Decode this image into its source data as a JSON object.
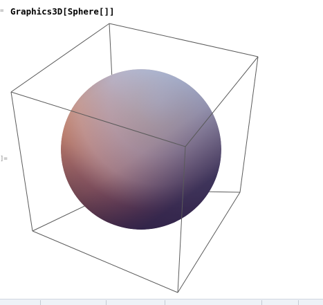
{
  "notebook": {
    "input_marker": "=",
    "input_code": "Graphics3D[Sphere[]]",
    "output_marker": "]="
  },
  "graphic": {
    "object": "sphere",
    "shading_colors": {
      "highlight": "#fffbe0",
      "warm": "#f0a868",
      "cool": "#b8d4f4",
      "shadow": "#3d2a58",
      "deep": "#5a2c3c"
    },
    "box_edge_color": "#5a5a5a"
  }
}
